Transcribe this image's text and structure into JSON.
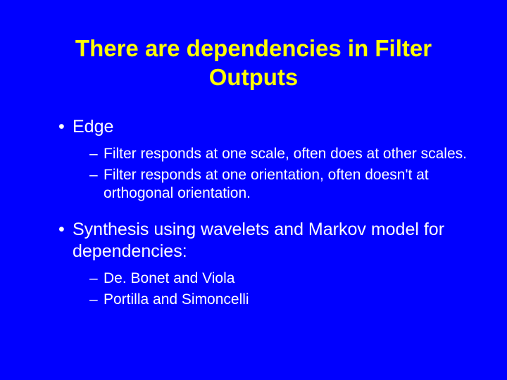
{
  "title": "There are dependencies in Filter Outputs",
  "groups": [
    {
      "heading": "Edge",
      "subs": [
        "Filter responds at one scale, often does at other scales.",
        "Filter responds at one orientation, often doesn't at orthogonal orientation."
      ]
    },
    {
      "heading": "Synthesis using wavelets and Markov model for dependencies:",
      "subs": [
        "De. Bonet and Viola",
        "Portilla and Simoncelli"
      ]
    }
  ]
}
